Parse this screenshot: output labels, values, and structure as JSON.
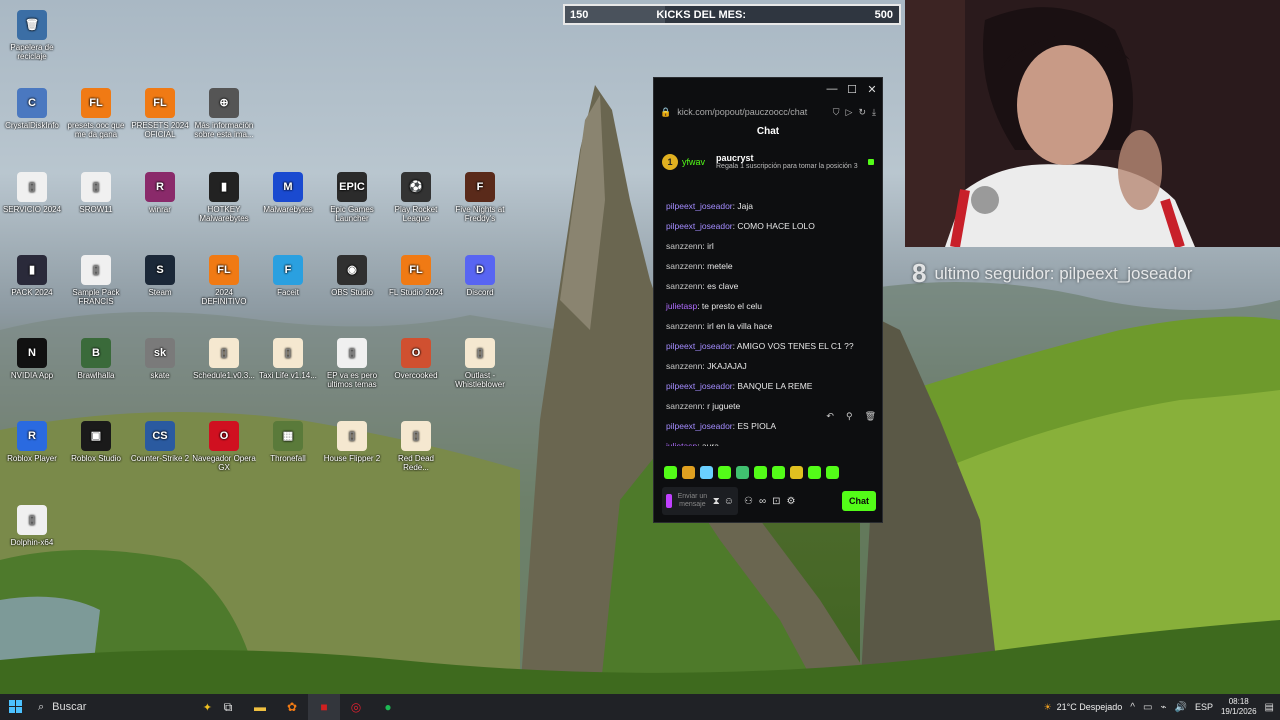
{
  "desktop_icons": [
    {
      "id": "recycle-bin",
      "label": "Papelera de reciclaje",
      "color": "#3b6ea5",
      "glyph": "🗑"
    },
    {
      "id": "crystaldiskinfo",
      "label": "CrystalDiskInfo",
      "color": "#4a78c0",
      "glyph": "C"
    },
    {
      "id": "fl-presets",
      "label": "presets.ooc que me da gana",
      "color": "#f07a14",
      "glyph": "FL"
    },
    {
      "id": "fl-presets-2",
      "label": "PRESETS 2024 OFICIAL",
      "color": "#f07a14",
      "glyph": "FL"
    },
    {
      "id": "mas-info",
      "label": "Más información sobre esta ima...",
      "color": "#555555",
      "glyph": "⊕"
    },
    {
      "id": "servicio-2024",
      "label": "SERVICIO 2024",
      "color": "#f0f0f0",
      "glyph": "▯"
    },
    {
      "id": "srow11",
      "label": "SROW11",
      "color": "#f0f0f0",
      "glyph": "▯"
    },
    {
      "id": "winrar",
      "label": "winrar",
      "color": "#8a2a6a",
      "glyph": "R"
    },
    {
      "id": "hotkey",
      "label": "HOTKEY Malwarebytes",
      "color": "#222222",
      "glyph": "▮"
    },
    {
      "id": "malwarebytes",
      "label": "Malwarebytes",
      "color": "#1a4ad0",
      "glyph": "M"
    },
    {
      "id": "epic-games",
      "label": "Epic Games Launcher",
      "color": "#2b2b2b",
      "glyph": "EPIC"
    },
    {
      "id": "rocket-league",
      "label": "Play Rocket League",
      "color": "#333333",
      "glyph": "⚽"
    },
    {
      "id": "fnaf",
      "label": "Five Nights at Freddy's",
      "color": "#5a2a1a",
      "glyph": "F"
    },
    {
      "id": "pack-2024",
      "label": "PACK 2024",
      "color": "#2a2a3a",
      "glyph": "▮"
    },
    {
      "id": "sample-pack",
      "label": "Sample Pack FRANCIS",
      "color": "#f0f0f0",
      "glyph": "▯"
    },
    {
      "id": "steam",
      "label": "Steam",
      "color": "#1b2838",
      "glyph": "S"
    },
    {
      "id": "fl-definitivo",
      "label": "2024 DEFINITIVO",
      "color": "#f07a14",
      "glyph": "FL"
    },
    {
      "id": "faceit",
      "label": "Faceit",
      "color": "#2aa0e0",
      "glyph": "F"
    },
    {
      "id": "obs",
      "label": "OBS Studio",
      "color": "#303030",
      "glyph": "◉"
    },
    {
      "id": "fl-studio",
      "label": "FL Studio 2024",
      "color": "#f07a14",
      "glyph": "FL"
    },
    {
      "id": "discord",
      "label": "Discord",
      "color": "#5865f2",
      "glyph": "D"
    },
    {
      "id": "nvidia",
      "label": "NVIDIA App",
      "color": "#111111",
      "glyph": "N"
    },
    {
      "id": "brawlhalla",
      "label": "Brawlhalla",
      "color": "#3a6a3a",
      "glyph": "B"
    },
    {
      "id": "skate",
      "label": "skate",
      "color": "#7a7a7a",
      "glyph": "sk"
    },
    {
      "id": "schedule",
      "label": "Schedule1.v0.3...",
      "color": "#f5e8d0",
      "glyph": "▯"
    },
    {
      "id": "taxi-life",
      "label": "Taxi Life v1.14...",
      "color": "#f5e8d0",
      "glyph": "▯"
    },
    {
      "id": "ep-para",
      "label": "EP va es pero ultimos temas",
      "color": "#f0f0f0",
      "glyph": "▯"
    },
    {
      "id": "overcooked",
      "label": "Overcooked",
      "color": "#d05030",
      "glyph": "O"
    },
    {
      "id": "outlast",
      "label": "Outlast - Whistleblower",
      "color": "#f5e8d0",
      "glyph": "▯"
    },
    {
      "id": "roblox-player",
      "label": "Roblox Player",
      "color": "#2a6ae0",
      "glyph": "R"
    },
    {
      "id": "roblox-studio",
      "label": "Roblox Studio",
      "color": "#1a1a1a",
      "glyph": "▣"
    },
    {
      "id": "counter-strike",
      "label": "Counter-Strike 2",
      "color": "#2a5aa0",
      "glyph": "CS"
    },
    {
      "id": "opera-gx",
      "label": "Navegador Opera GX",
      "color": "#d01020",
      "glyph": "O"
    },
    {
      "id": "thronefall",
      "label": "Thronefall",
      "color": "#5a7a3a",
      "glyph": "▦"
    },
    {
      "id": "house-flipper",
      "label": "House Flipper 2",
      "color": "#f5e8d0",
      "glyph": "▯"
    },
    {
      "id": "red-dead",
      "label": "Red Dead Rede...",
      "color": "#f5e8d0",
      "glyph": "▯"
    },
    {
      "id": "dolphin",
      "label": "Dolphin-x64",
      "color": "#f0f0f0",
      "glyph": "▯"
    }
  ],
  "kicks": {
    "current": "150",
    "title": "KICKS DEL MES:",
    "goal": "500",
    "progress_fraction": 0.3
  },
  "follower": {
    "count": "8",
    "label": "ultimo seguidor: pilpeext_joseador"
  },
  "chat": {
    "url": "kick.com/popout/pauczoocc/chat",
    "title": "Chat",
    "pinned": {
      "badge": "1",
      "user": "yfwav",
      "name": "paucryst",
      "desc": "Regala 1 suscripción para tomar la posición 3"
    },
    "messages": [
      {
        "user": "pilpeext_joseador",
        "user_color": "#a48cff",
        "text": ": Jaja"
      },
      {
        "user": "pilpeext_joseador",
        "user_color": "#a48cff",
        "text": ": COMO HACE LOLO"
      },
      {
        "user": "sanzzenn",
        "user_color": "#c8c8c8",
        "text": ": irl"
      },
      {
        "user": "sanzzenn",
        "user_color": "#c8c8c8",
        "text": ": metele"
      },
      {
        "user": "sanzzenn",
        "user_color": "#c8c8c8",
        "text": ": es clave"
      },
      {
        "user": "julietasp",
        "user_color": "#b06cff",
        "text": ": te presto el celu"
      },
      {
        "user": "sanzzenn",
        "user_color": "#c8c8c8",
        "text": ": irl en la villa hace"
      },
      {
        "user": "pilpeext_joseador",
        "user_color": "#a48cff",
        "text": ": AMIGO VOS TENES EL C1 ??"
      },
      {
        "user": "sanzzenn",
        "user_color": "#c8c8c8",
        "text": ": JKAJAJAJ"
      },
      {
        "user": "pilpeext_joseador",
        "user_color": "#a48cff",
        "text": ": BANQUE LA REME"
      },
      {
        "user": "sanzzenn",
        "user_color": "#c8c8c8",
        "text": ": r juguete"
      },
      {
        "user": "pilpeext_joseador",
        "user_color": "#a48cff",
        "text": ": ES PIOLA"
      },
      {
        "user": "julietasp",
        "user_color": "#b06cff",
        "text": ": aura"
      }
    ],
    "input_placeholder": "Enviar un mensaje",
    "send_label": "Chat",
    "emote_colors": [
      "#53fc18",
      "#e0a020",
      "#6ad0ff",
      "#53fc18",
      "#40c070",
      "#53fc18",
      "#53fc18",
      "#e0c020",
      "#53fc18",
      "#53fc18"
    ]
  },
  "taskbar": {
    "search_label": "Buscar",
    "weather": "21°C Despejado",
    "lang": "ESP",
    "time": "08:18",
    "date": "19/1/2026"
  }
}
